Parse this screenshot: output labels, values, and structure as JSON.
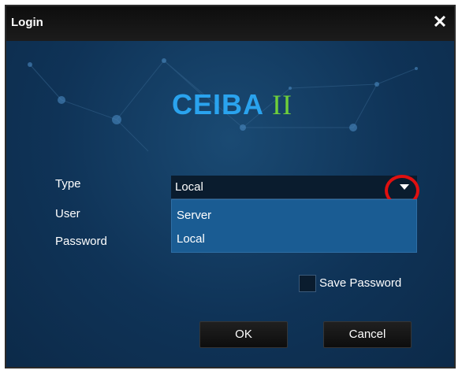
{
  "window": {
    "title": "Login",
    "close_symbol": "✕"
  },
  "logo": {
    "text": "CEIBA",
    "roman": "II"
  },
  "form": {
    "type_label": "Type",
    "user_label": "User",
    "password_label": "Password",
    "type_selected": "Local",
    "type_options": [
      "Server",
      "Local"
    ],
    "save_password_label": "Save Password"
  },
  "buttons": {
    "ok": "OK",
    "cancel": "Cancel"
  },
  "colors": {
    "background": "#0f3254",
    "logo_text": "#2aa3ee",
    "logo_roman": "#6fcf3a",
    "dropdown_bg": "#1a5c93",
    "highlight_ring": "#e01010"
  },
  "icons": {
    "close": "close-icon",
    "dropdown": "chevron-down-icon"
  }
}
